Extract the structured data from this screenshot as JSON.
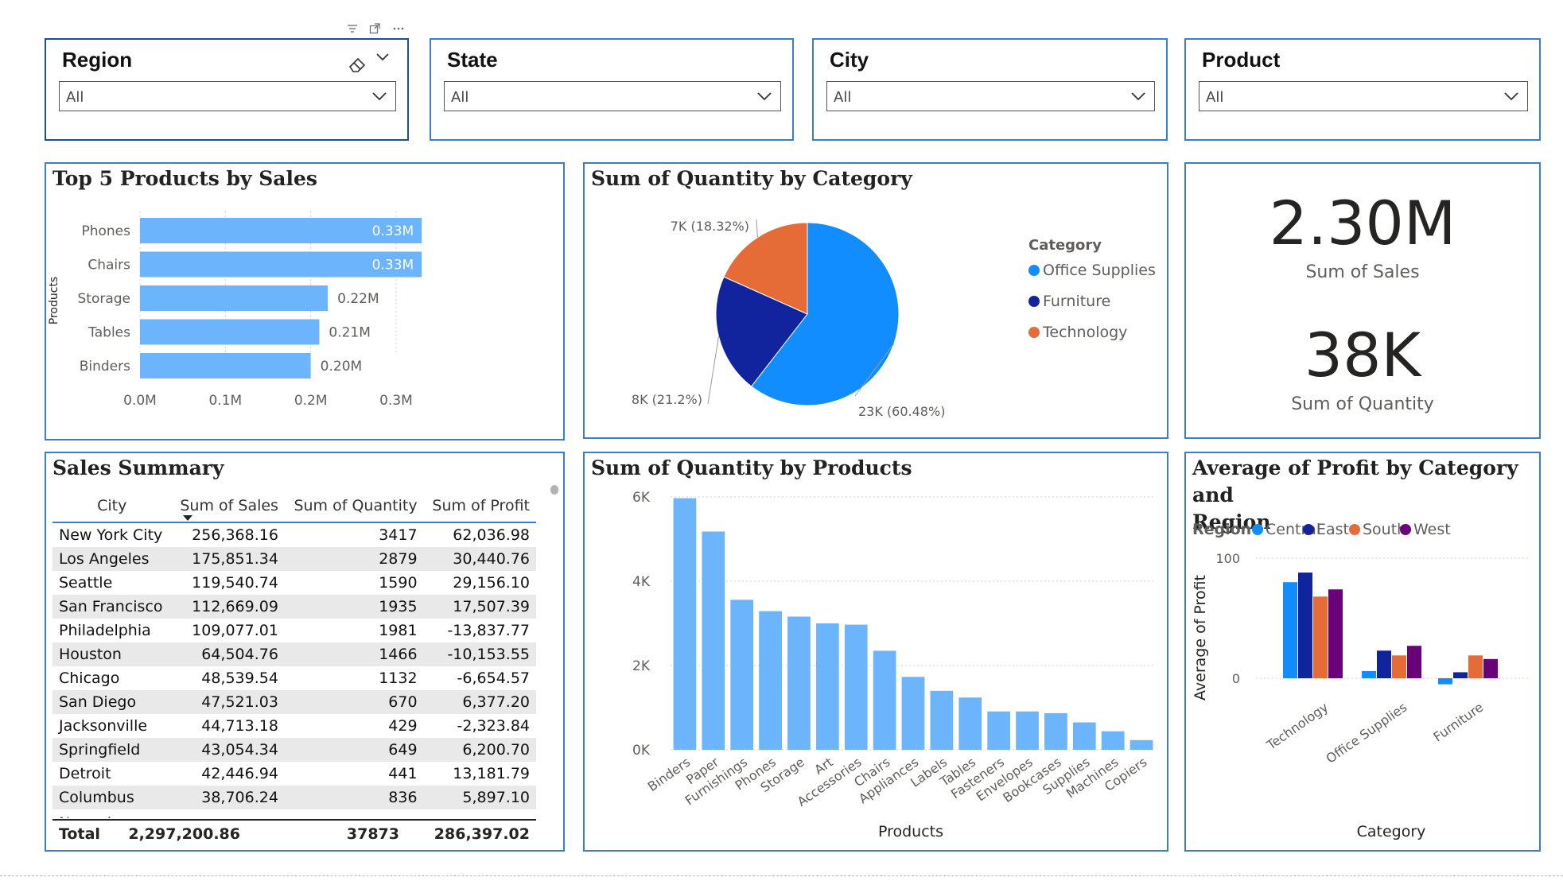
{
  "slicers": [
    {
      "title": "Region",
      "value": "All"
    },
    {
      "title": "State",
      "value": "All"
    },
    {
      "title": "City",
      "value": "All"
    },
    {
      "title": "Product",
      "value": "All"
    }
  ],
  "top5": {
    "title": "Top 5 Products by Sales",
    "y_axis_label": "Products",
    "chart_data": {
      "type": "bar",
      "categories": [
        "Phones",
        "Chairs",
        "Storage",
        "Tables",
        "Binders"
      ],
      "values": [
        0.33,
        0.33,
        0.22,
        0.21,
        0.2
      ],
      "data_labels": [
        "0.33M",
        "0.33M",
        "0.22M",
        "0.21M",
        "0.20M"
      ],
      "x_ticks": [
        "0.0M",
        "0.1M",
        "0.2M",
        "0.3M"
      ],
      "xlim": [
        0,
        0.35
      ],
      "unit": "M",
      "color": "#6cb4fb"
    }
  },
  "pie": {
    "title": "Sum of Quantity by Category",
    "legend_title": "Category",
    "chart_data": {
      "type": "pie",
      "categories": [
        "Office Supplies",
        "Furniture",
        "Technology"
      ],
      "values": [
        60.48,
        21.2,
        18.32
      ],
      "labels": [
        "23K (60.48%)",
        "8K (21.2%)",
        "7K (18.32%)"
      ],
      "colors": [
        "#118dff",
        "#12239e",
        "#e66c37"
      ]
    }
  },
  "kpi": {
    "sales_value": "2.30M",
    "sales_label": "Sum of Sales",
    "qty_value": "38K",
    "qty_label": "Sum of Quantity"
  },
  "summary": {
    "title": "Sales Summary",
    "columns": [
      "City",
      "Sum of Sales",
      "Sum of Quantity",
      "Sum of Profit"
    ],
    "rows": [
      [
        "New York City",
        "256,368.16",
        "3417",
        "62,036.98"
      ],
      [
        "Los Angeles",
        "175,851.34",
        "2879",
        "30,440.76"
      ],
      [
        "Seattle",
        "119,540.74",
        "1590",
        "29,156.10"
      ],
      [
        "San Francisco",
        "112,669.09",
        "1935",
        "17,507.39"
      ],
      [
        "Philadelphia",
        "109,077.01",
        "1981",
        "-13,837.77"
      ],
      [
        "Houston",
        "64,504.76",
        "1466",
        "-10,153.55"
      ],
      [
        "Chicago",
        "48,539.54",
        "1132",
        "-6,654.57"
      ],
      [
        "San Diego",
        "47,521.03",
        "670",
        "6,377.20"
      ],
      [
        "Jacksonville",
        "44,713.18",
        "429",
        "-2,323.84"
      ],
      [
        "Springfield",
        "43,054.34",
        "649",
        "6,200.70"
      ],
      [
        "Detroit",
        "42,446.94",
        "441",
        "13,181.79"
      ],
      [
        "Columbus",
        "38,706.24",
        "836",
        "5,897.10"
      ]
    ],
    "total": [
      "Total",
      "2,297,200.86",
      "37873",
      "286,397.02"
    ]
  },
  "qtyprod": {
    "title": "Sum of Quantity by Products",
    "x_axis_label": "Products",
    "chart_data": {
      "type": "bar",
      "categories": [
        "Binders",
        "Paper",
        "Furnishings",
        "Phones",
        "Storage",
        "Art",
        "Accessories",
        "Chairs",
        "Appliances",
        "Labels",
        "Tables",
        "Fasteners",
        "Envelopes",
        "Bookcases",
        "Supplies",
        "Machines",
        "Copiers"
      ],
      "values": [
        5970,
        5180,
        3560,
        3290,
        3160,
        3000,
        2970,
        2350,
        1730,
        1400,
        1240,
        910,
        910,
        870,
        650,
        440,
        230
      ],
      "y_ticks": [
        "0K",
        "2K",
        "4K",
        "6K"
      ],
      "ylim": [
        0,
        6000
      ],
      "color": "#6cb4fb"
    }
  },
  "profit": {
    "title_line1": "Average of Profit by Category and",
    "title_line2": "Region",
    "legend_title": "Region",
    "y_axis_label": "Average of Profit",
    "x_axis_label": "Category",
    "chart_data": {
      "type": "bar",
      "categories": [
        "Technology",
        "Office Supplies",
        "Furniture"
      ],
      "series": [
        {
          "name": "Central",
          "values": [
            80,
            6,
            -5
          ],
          "color": "#118dff"
        },
        {
          "name": "East",
          "values": [
            88,
            23,
            5
          ],
          "color": "#12239e"
        },
        {
          "name": "South",
          "values": [
            68,
            19,
            19
          ],
          "color": "#e66c37"
        },
        {
          "name": "West",
          "values": [
            74,
            27,
            16
          ],
          "color": "#6b007b"
        }
      ],
      "y_ticks": [
        "0",
        "100"
      ],
      "ylim": [
        -12,
        100
      ]
    }
  }
}
